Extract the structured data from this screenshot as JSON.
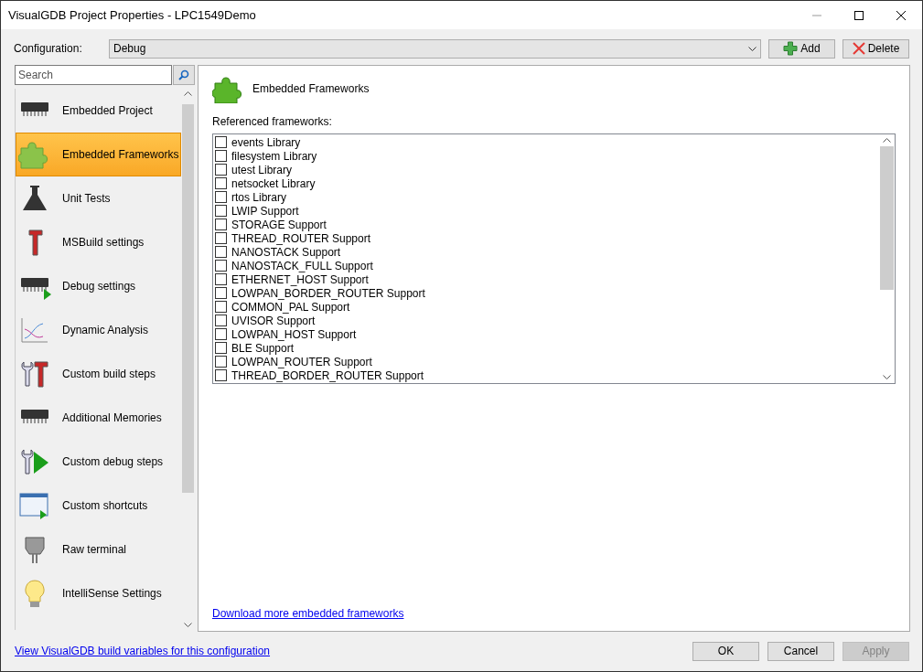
{
  "window": {
    "title": "VisualGDB Project Properties - LPC1549Demo"
  },
  "configuration": {
    "label": "Configuration:",
    "value": "Debug",
    "buttons": [
      "Add",
      "Delete"
    ]
  },
  "search": {
    "placeholder": "Search"
  },
  "sidebar": {
    "items": [
      {
        "label": "Embedded Project",
        "kind": "chip",
        "selected": false
      },
      {
        "label": "Embedded Frameworks",
        "kind": "puzzle",
        "selected": true
      },
      {
        "label": "Unit Tests",
        "kind": "flask",
        "selected": false
      },
      {
        "label": "MSBuild settings",
        "kind": "hammer",
        "selected": false
      },
      {
        "label": "Debug settings",
        "kind": "chipplay",
        "selected": false
      },
      {
        "label": "Dynamic Analysis",
        "kind": "chart",
        "selected": false
      },
      {
        "label": "Custom build steps",
        "kind": "tools",
        "selected": false
      },
      {
        "label": "Additional Memories",
        "kind": "chip",
        "selected": false
      },
      {
        "label": "Custom debug steps",
        "kind": "wrenchplay",
        "selected": false
      },
      {
        "label": "Custom shortcuts",
        "kind": "window",
        "selected": false
      },
      {
        "label": "Raw terminal",
        "kind": "connector",
        "selected": false
      },
      {
        "label": "IntelliSense Settings",
        "kind": "bulb",
        "selected": false
      }
    ]
  },
  "page": {
    "title": "Embedded Frameworks",
    "list_label": "Referenced frameworks:",
    "frameworks": [
      {
        "label": "events Library",
        "checked": false
      },
      {
        "label": "filesystem Library",
        "checked": false
      },
      {
        "label": "utest Library",
        "checked": false
      },
      {
        "label": "netsocket Library",
        "checked": false
      },
      {
        "label": "rtos Library",
        "checked": false
      },
      {
        "label": "LWIP Support",
        "checked": false
      },
      {
        "label": "STORAGE Support",
        "checked": false
      },
      {
        "label": "THREAD_ROUTER Support",
        "checked": false
      },
      {
        "label": "NANOSTACK Support",
        "checked": false
      },
      {
        "label": "NANOSTACK_FULL Support",
        "checked": false
      },
      {
        "label": "ETHERNET_HOST Support",
        "checked": false
      },
      {
        "label": "LOWPAN_BORDER_ROUTER Support",
        "checked": false
      },
      {
        "label": "COMMON_PAL Support",
        "checked": false
      },
      {
        "label": "UVISOR Support",
        "checked": false
      },
      {
        "label": "LOWPAN_HOST Support",
        "checked": false
      },
      {
        "label": "BLE Support",
        "checked": false
      },
      {
        "label": "LOWPAN_ROUTER Support",
        "checked": false
      },
      {
        "label": "THREAD_BORDER_ROUTER Support",
        "checked": false
      }
    ],
    "link": "Download more embedded frameworks"
  },
  "footer": {
    "link": "View VisualGDB build variables for this configuration",
    "buttons": [
      {
        "label": "OK",
        "disabled": false
      },
      {
        "label": "Cancel",
        "disabled": false
      },
      {
        "label": "Apply",
        "disabled": true
      }
    ]
  }
}
